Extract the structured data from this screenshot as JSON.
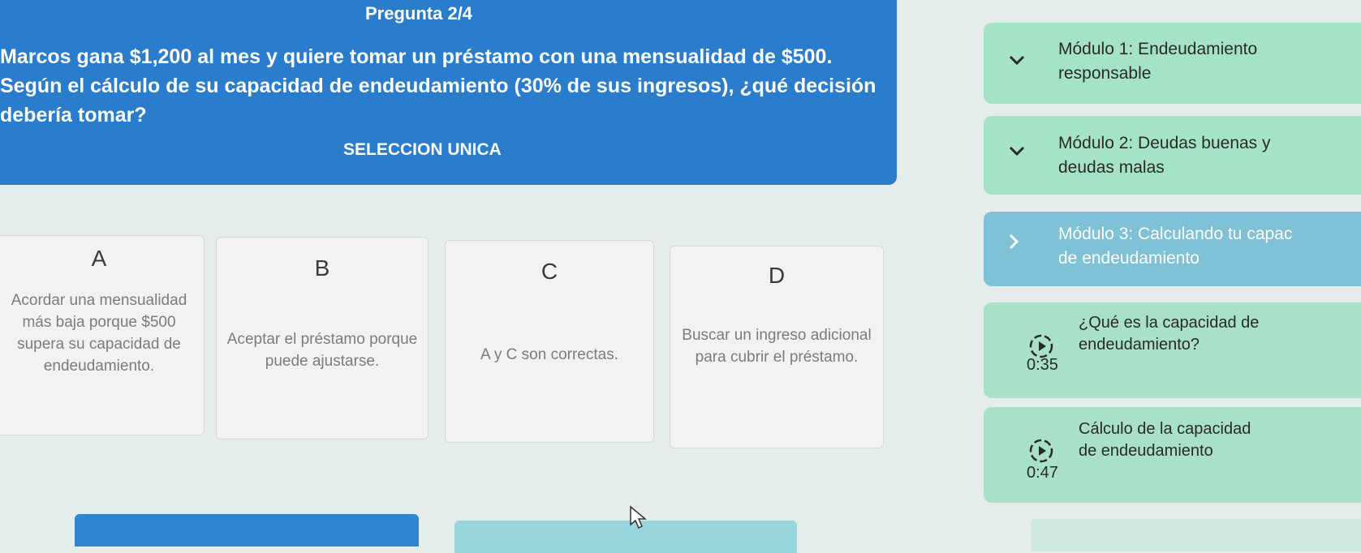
{
  "question": {
    "counter": "Pregunta 2/4",
    "text": "Marcos gana $1,200 al mes y quiere tomar un préstamo con una mensualidad de $500. Según el cálculo de su capacidad de endeudamiento (30% de sus ingresos), ¿qué decisión debería tomar?",
    "type": "SELECCION UNICA"
  },
  "options": [
    {
      "letter": "A",
      "text": "Acordar una mensualidad más baja porque $500 supera su capacidad de endeudamiento."
    },
    {
      "letter": "B",
      "text": "Aceptar el préstamo porque puede ajustarse."
    },
    {
      "letter": "C",
      "text": "A y C son correctas."
    },
    {
      "letter": "D",
      "text": "Buscar un ingreso adicional para cubrir el préstamo."
    }
  ],
  "sidebar": {
    "modules": [
      {
        "title_line1": "Módulo 1: Endeudamiento",
        "title_line2": "responsable",
        "state": "expanded"
      },
      {
        "title_line1": "Módulo 2: Deudas buenas y",
        "title_line2": "deudas malas",
        "state": "expanded"
      },
      {
        "title_line1": "Módulo 3: Calculando tu capac",
        "title_line2": "de endeudamiento",
        "state": "collapsed"
      }
    ],
    "lessons": [
      {
        "title_line1": "¿Qué es la capacidad de",
        "title_line2": "endeudamiento?",
        "duration": "0:35"
      },
      {
        "title_line1": "Cálculo de la capacidad",
        "title_line2": "de endeudamiento",
        "duration": "0:47"
      }
    ]
  },
  "icons": {
    "module_expanded": "chevron-down-icon",
    "module_collapsed": "chevron-right-icon",
    "lesson": "play-circle-icon",
    "pointer": "mouse-cursor-icon"
  },
  "colors": {
    "question_bg": "#2a7ccd",
    "module_bg": "#a5e3c6",
    "module_active_bg": "#7fc2d8",
    "option_bg": "#f2f2f2",
    "page_bg": "#e4ecec"
  }
}
